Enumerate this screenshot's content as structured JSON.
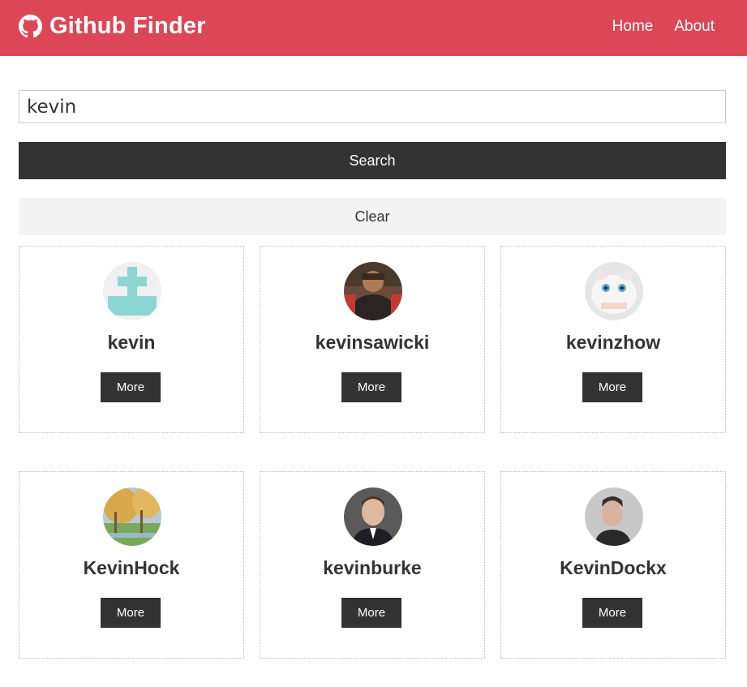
{
  "navbar": {
    "brand_icon": "github-icon",
    "title": "Github Finder",
    "links": [
      "Home",
      "About"
    ],
    "color": "#dc4757"
  },
  "search": {
    "value": "kevin",
    "search_label": "Search",
    "clear_label": "Clear"
  },
  "users": [
    {
      "login": "kevin",
      "more_label": "More",
      "avatar": "identicon-avatar"
    },
    {
      "login": "kevinsawicki",
      "more_label": "More",
      "avatar": "photo-avatar"
    },
    {
      "login": "kevinzhow",
      "more_label": "More",
      "avatar": "cat-avatar"
    },
    {
      "login": "KevinHock",
      "more_label": "More",
      "avatar": "painting-avatar"
    },
    {
      "login": "kevinburke",
      "more_label": "More",
      "avatar": "photo-avatar"
    },
    {
      "login": "KevinDockx",
      "more_label": "More",
      "avatar": "photo-avatar"
    }
  ]
}
